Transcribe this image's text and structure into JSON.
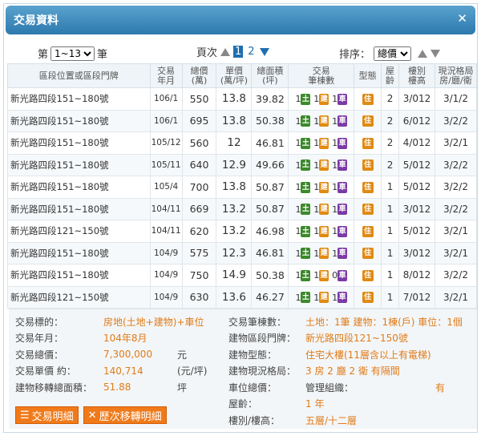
{
  "window": {
    "title": "交易資料",
    "close_icon": "✕"
  },
  "toolbar": {
    "page_prefix": "第",
    "page_select": "1~13",
    "page_suffix": "筆",
    "page_label": "頁次",
    "pages": [
      "1",
      "2"
    ],
    "sort_label": "排序：",
    "sort_select": "總價"
  },
  "table": {
    "headers": [
      "區段位置或區段門牌",
      "交易\n年月",
      "總價\n(萬)",
      "單價\n(萬/坪)",
      "總面積\n(坪)",
      "交易\n筆棟數",
      "型態",
      "屋\n齡",
      "樓別\n樓高",
      "現況格局\n房/廳/衛"
    ],
    "badges": {
      "land": "土",
      "bldg": "建",
      "car": "車",
      "use": "住"
    },
    "rows": [
      {
        "addr": "新光路四段151~180號",
        "ym": "106/1",
        "total": "550",
        "unit": "13.8",
        "area": "39.82",
        "n1": "1",
        "n2": "1",
        "n3": "1",
        "age": "2",
        "floor": "3/012",
        "layout": "3/1/2"
      },
      {
        "addr": "新光路四段151~180號",
        "ym": "106/1",
        "total": "695",
        "unit": "13.8",
        "area": "50.38",
        "n1": "1",
        "n2": "1",
        "n3": "1",
        "age": "2",
        "floor": "6/012",
        "layout": "3/2/2"
      },
      {
        "addr": "新光路四段151~180號",
        "ym": "105/12",
        "total": "560",
        "unit": "12",
        "area": "46.81",
        "n1": "1",
        "n2": "1",
        "n3": "1",
        "age": "2",
        "floor": "4/012",
        "layout": "3/2/1"
      },
      {
        "addr": "新光路四段151~180號",
        "ym": "105/11",
        "total": "640",
        "unit": "12.9",
        "area": "49.66",
        "n1": "1",
        "n2": "1",
        "n3": "1",
        "age": "2",
        "floor": "5/012",
        "layout": "3/2/2"
      },
      {
        "addr": "新光路四段151~180號",
        "ym": "105/4",
        "total": "700",
        "unit": "13.8",
        "area": "50.87",
        "n1": "1",
        "n2": "1",
        "n3": "1",
        "age": "1",
        "floor": "5/012",
        "layout": "3/2/2"
      },
      {
        "addr": "新光路四段151~180號",
        "ym": "104/11",
        "total": "669",
        "unit": "13.2",
        "area": "50.87",
        "n1": "1",
        "n2": "1",
        "n3": "1",
        "age": "1",
        "floor": "3/012",
        "layout": "3/2/2"
      },
      {
        "addr": "新光路四段121~150號",
        "ym": "104/11",
        "total": "620",
        "unit": "13.2",
        "area": "46.98",
        "n1": "1",
        "n2": "1",
        "n3": "1",
        "age": "1",
        "floor": "5/012",
        "layout": "3/2/1"
      },
      {
        "addr": "新光路四段151~180號",
        "ym": "104/9",
        "total": "575",
        "unit": "12.3",
        "area": "46.81",
        "n1": "1",
        "n2": "1",
        "n3": "1",
        "age": "1",
        "floor": "3/012",
        "layout": "3/2/1"
      },
      {
        "addr": "新光路四段151~180號",
        "ym": "104/9",
        "total": "750",
        "unit": "14.9",
        "area": "50.38",
        "n1": "1",
        "n2": "1",
        "n3": "0",
        "age": "1",
        "floor": "8/012",
        "layout": "3/2/2"
      },
      {
        "addr": "新光路四段121~150號",
        "ym": "104/9",
        "total": "630",
        "unit": "13.6",
        "area": "46.27",
        "n1": "1",
        "n2": "1",
        "n3": "1",
        "age": "1",
        "floor": "7/012",
        "layout": "3/2/1"
      }
    ]
  },
  "detail": {
    "left": [
      {
        "label": "交易標的：",
        "value": "房地(土地+建物)+車位",
        "unit": ""
      },
      {
        "label": "交易年月：",
        "value": "104年8月",
        "unit": ""
      },
      {
        "label": "交易總價：",
        "value": "7,300,000",
        "unit": "元"
      },
      {
        "label": "交易單價 約：",
        "value": "140,714",
        "unit": "(元/坪)"
      },
      {
        "label": "建物移轉總面積：",
        "value": "51.88",
        "unit": "坪"
      }
    ],
    "right": [
      {
        "label": "交易筆棟數：",
        "value": "土地：1筆 建物：1棟(戶) 車位：1個"
      },
      {
        "label": "建物區段門牌：",
        "value": "新光路四段121~150號"
      },
      {
        "label": "建物型態：",
        "value": "住宅大樓(11層含以上有電梯)"
      },
      {
        "label": "建物現況格局：",
        "value": "3 房 2 廳 2 衛 有隔間"
      },
      {
        "label": "車位總價：",
        "value": "管理組織：",
        "value2": "有"
      },
      {
        "label": "屋齡：",
        "value": "1 年"
      },
      {
        "label": "樓別/樓高：",
        "value": "五層/十二層"
      }
    ],
    "buttons": [
      "交易明細",
      "歷次移轉明細"
    ]
  }
}
